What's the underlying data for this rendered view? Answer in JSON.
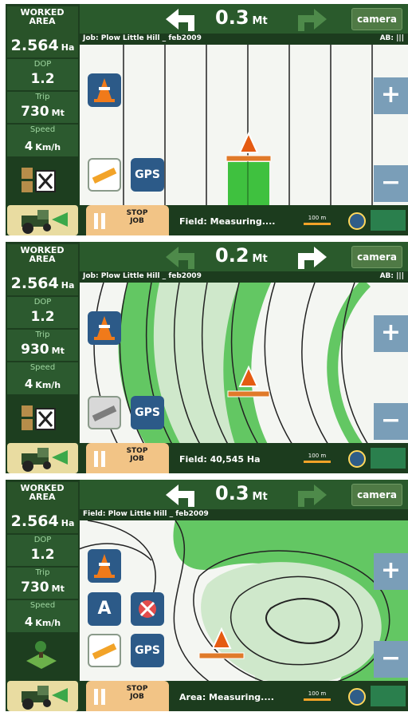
{
  "panels": [
    {
      "worked_label": "WORKED AREA",
      "worked_value": "2.564",
      "worked_unit": "Ha",
      "dop_label": "DOP",
      "dop_value": "1.2",
      "trip_label": "Trip",
      "trip_value": "730",
      "trip_unit": "Mt",
      "speed_label": "Speed",
      "speed_value": "4",
      "speed_unit": "Km/h",
      "distance": "0.3",
      "distance_unit": "Mt",
      "camera_label": "camera",
      "job_line": "Job: Plow Little Hill _ feb2009",
      "ab_label": "AB: |||",
      "stop_label": "STOP JOB",
      "status_text": "Field: Measuring....",
      "scale_label": "100 m",
      "gps_label": "GPS",
      "active_arrow": "left"
    },
    {
      "worked_label": "WORKED AREA",
      "worked_value": "2.564",
      "worked_unit": "Ha",
      "dop_label": "DOP",
      "dop_value": "1.2",
      "trip_label": "Trip",
      "trip_value": "930",
      "trip_unit": "Mt",
      "speed_label": "Speed",
      "speed_value": "4",
      "speed_unit": "Km/h",
      "distance": "0.2",
      "distance_unit": "Mt",
      "camera_label": "camera",
      "job_line": "Job: Plow Little Hill _ feb2009",
      "ab_label": "AB: |||",
      "stop_label": "STOP JOB",
      "status_text": "Field: 40,545 Ha",
      "scale_label": "100 m",
      "gps_label": "GPS",
      "active_arrow": "right"
    },
    {
      "worked_label": "WORKED AREA",
      "worked_value": "2.564",
      "worked_unit": "Ha",
      "dop_label": "DOP",
      "dop_value": "1.2",
      "trip_label": "Trip",
      "trip_value": "730",
      "trip_unit": "Mt",
      "speed_label": "Speed",
      "speed_value": "4",
      "speed_unit": "Km/h",
      "distance": "0.3",
      "distance_unit": "Mt",
      "camera_label": "camera",
      "job_line": "Field: Plow Little Hill _ feb2009",
      "ab_label": "",
      "stop_label": "STOP JOB",
      "status_text": "Area: Measuring....",
      "scale_label": "100 m",
      "gps_label": "GPS",
      "a_label": "A",
      "active_arrow": "left"
    }
  ],
  "colors": {
    "sidebar_bg": "#1d3e1f",
    "stat_bg": "#2c5a2f",
    "track_green": "#3fc13f",
    "contour_green": "#63c763",
    "pale_green": "#cfe8cb",
    "stop_button": "#f2c486",
    "tool_blue": "#2c5a88",
    "cone_orange": "#f07a1a"
  },
  "icons": [
    "cone-icon",
    "gps-icon",
    "ruler-icon",
    "tractor-icon",
    "pause-icon",
    "compass-icon",
    "signal-icon",
    "left-arrow-icon",
    "right-arrow-icon",
    "plus-icon",
    "minus-icon",
    "checkbox-icon",
    "no-gps-icon",
    "field-icon"
  ]
}
